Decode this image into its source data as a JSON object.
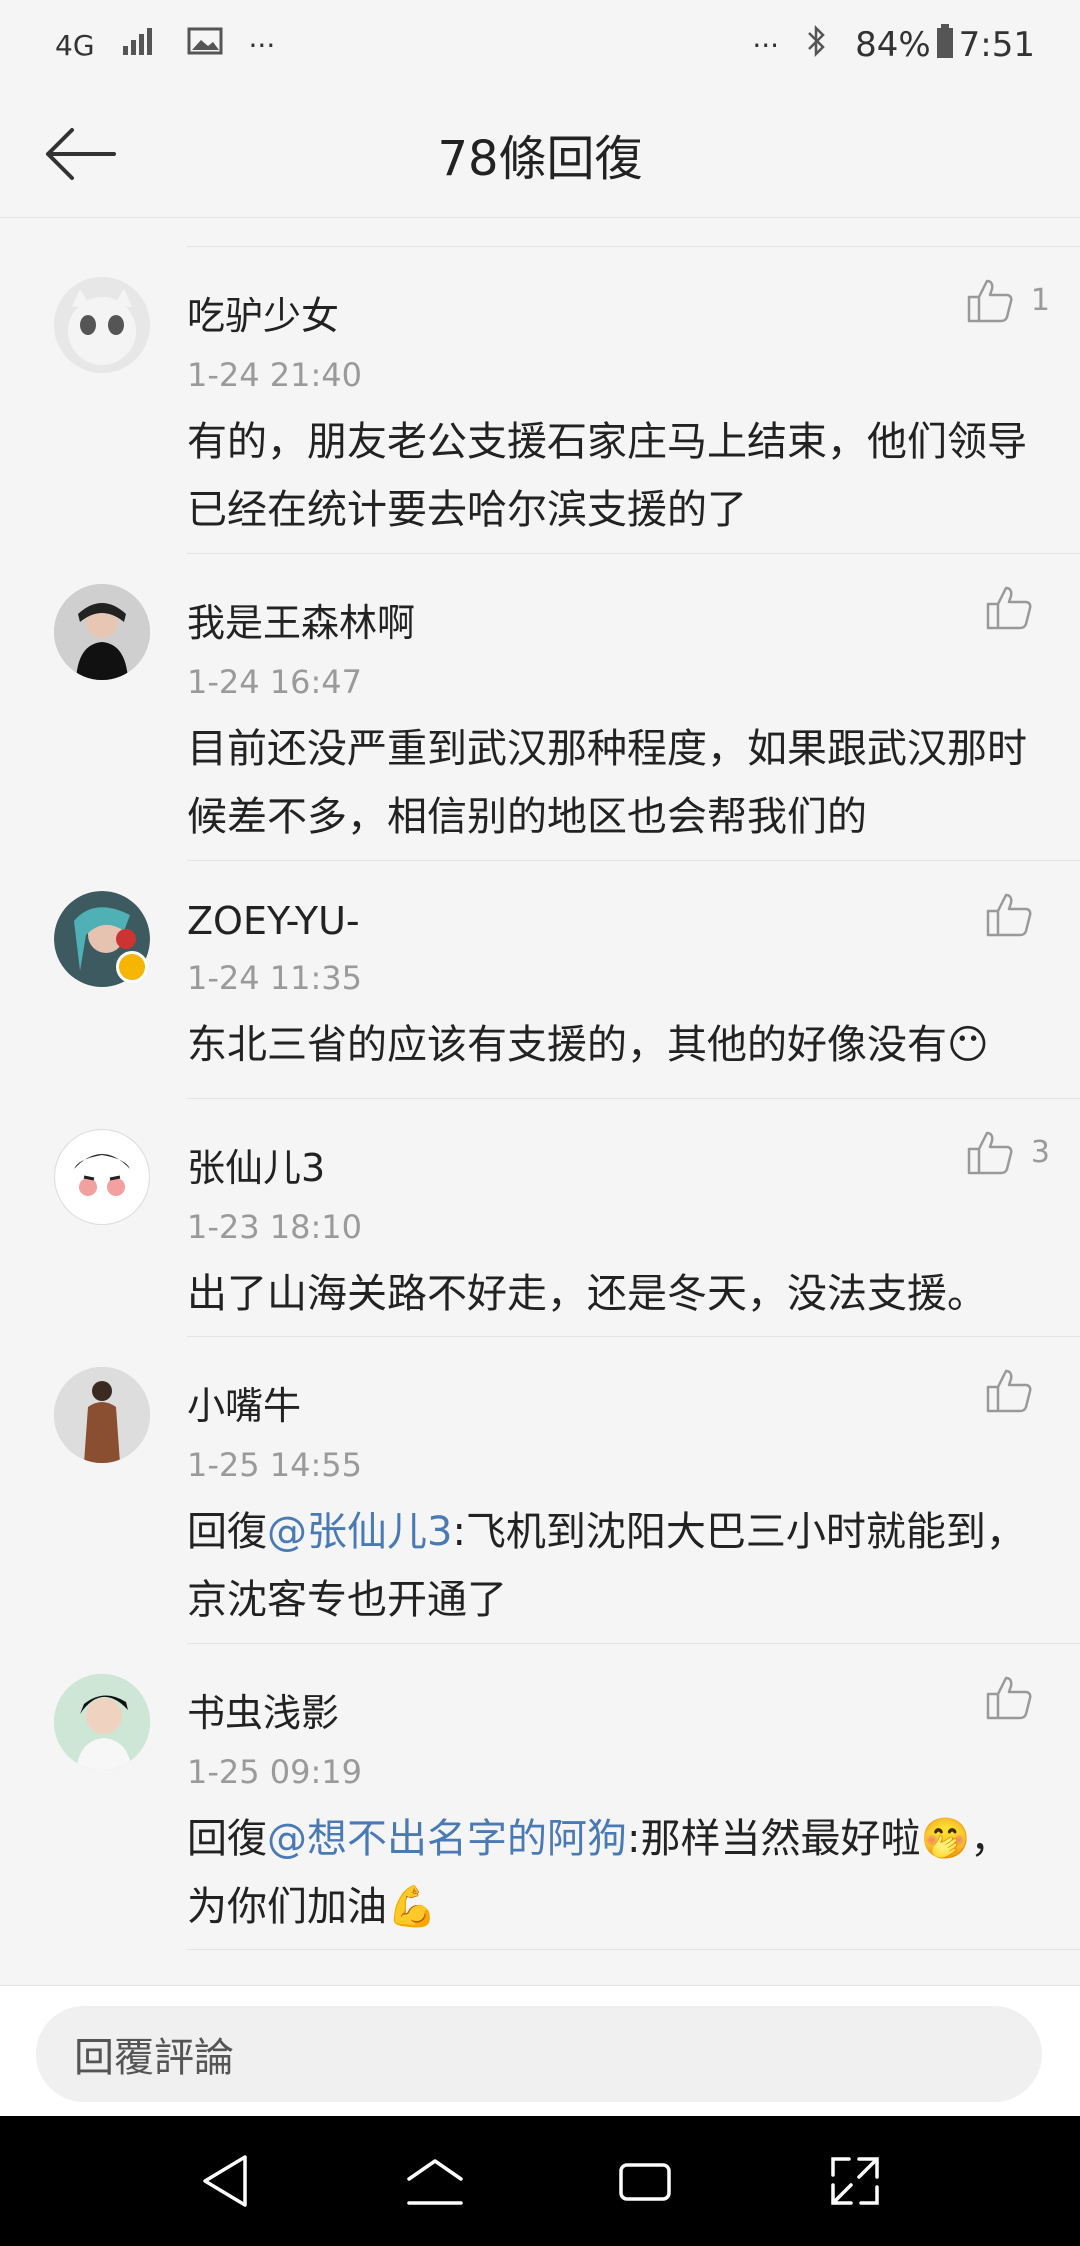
{
  "status": {
    "network": "4G",
    "dots": "···",
    "battery": "84%",
    "time": "7:51"
  },
  "header": {
    "title": "78條回復"
  },
  "comments": [
    {
      "name": "吃驴少女",
      "time": "1-24 21:40",
      "likes": "1",
      "text": "有的，朋友老公支援石家庄马上结束，他们领导已经在统计要去哈尔滨支援的了"
    },
    {
      "name": "我是王森林啊",
      "time": "1-24 16:47",
      "likes": "",
      "text": "目前还没严重到武汉那种程度，如果跟武汉那时候差不多，相信别的地区也会帮我们的"
    },
    {
      "name": "ZOEY-YU-",
      "time": "1-24 11:35",
      "likes": "",
      "text": "东北三省的应该有支援的，其他的好像没有😶"
    },
    {
      "name": "张仙儿3",
      "time": "1-23 18:10",
      "likes": "3",
      "text": "出了山海关路不好走，还是冬天，没法支援。"
    },
    {
      "name": "小嘴牛",
      "time": "1-25 14:55",
      "likes": "",
      "reply_prefix": "回復",
      "mention": "@张仙儿3",
      "text": ":飞机到沈阳大巴三小时就能到，京沈客专也开通了"
    },
    {
      "name": "书虫浅影",
      "time": "1-25 09:19",
      "likes": "",
      "reply_prefix": "回復",
      "mention": "@想不出名字的阿狗",
      "text": ":那样当然最好啦🤭，为你们加油💪"
    }
  ],
  "reply_bar": {
    "placeholder": "回覆評論"
  }
}
